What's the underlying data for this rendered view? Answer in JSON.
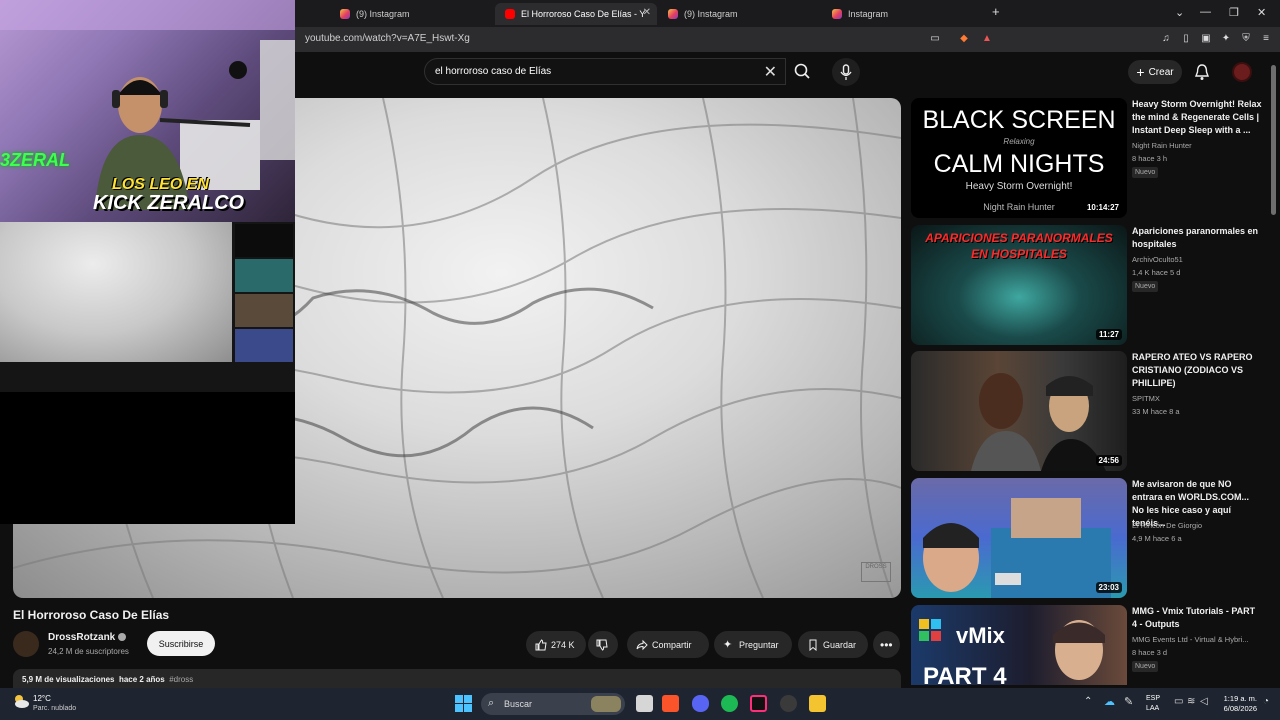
{
  "browser": {
    "tabs": [
      {
        "label": "(9) Instagram",
        "favicon": "instagram-icon",
        "active": false
      },
      {
        "label": "El Horroroso Caso De Elías - Y",
        "favicon": "youtube-icon",
        "active": true
      },
      {
        "label": "(9) Instagram",
        "favicon": "instagram-icon",
        "active": false
      },
      {
        "label": "Instagram",
        "favicon": "instagram-icon",
        "active": false
      }
    ],
    "new_tab_label": "+",
    "url": "youtube.com/watch?v=A7E_Hswt-Xg"
  },
  "youtube": {
    "search": {
      "value": "el horroroso caso de Elías"
    },
    "create_label": "Crear",
    "video": {
      "title": "El Horroroso Caso De Elías",
      "channel": "DrossRotzank",
      "subscribers": "24,2 M de suscriptores",
      "subscribe_label": "Suscribirse",
      "likes": "274 K",
      "share_label": "Compartir",
      "ask_label": "Preguntar",
      "save_label": "Guardar",
      "views": "5,9 M de visualizaciones",
      "age": "hace 2 años",
      "hashtag": "#dross",
      "watermark": "DROSS"
    },
    "recommendations": [
      {
        "title": "Heavy Storm Overnight! Relax the mind & Regenerate Cells | Instant Deep Sleep with a ...",
        "channel": "Night Rain Hunter",
        "meta": "8  hace 3 h",
        "badge": "Nuevo",
        "duration": "10:14:27",
        "thumb_lines": [
          "BLACK SCREEN",
          "Relaxing",
          "CALM NIGHTS",
          "Heavy Storm Overnight!",
          "Night Rain Hunter"
        ]
      },
      {
        "title": "Apariciones paranormales en hospitales",
        "channel": "ArchivOculto51",
        "meta": "1,4 K  hace 5 d",
        "badge": "Nuevo",
        "duration": "11:27",
        "thumb_lines": [
          "APARICIONES PARANORMALES",
          "EN HOSPITALES"
        ]
      },
      {
        "title": "RAPERO ATEO VS RAPERO CRISTIANO (ZODIACO VS PHILLIPE)",
        "channel": "SPITMX",
        "meta": "33 M  hace 8 a",
        "badge": "",
        "duration": "24:56"
      },
      {
        "title": "Me avisaron de que NO entrara en WORLDS.COM... No les hice caso y aquí tenéis...",
        "channel": "El Rincón De Giorgio",
        "meta": "4,9 M  hace 6 a",
        "badge": "",
        "duration": "23:03"
      },
      {
        "title": "MMG - Vmix Tutorials - PART 4 - Outputs",
        "channel": "MMG Events Ltd - Virtual & Hybri...",
        "meta": "8  hace 3 d",
        "badge": "Nuevo",
        "duration": "",
        "thumb_lines": [
          "vMix",
          "PART 4"
        ]
      }
    ]
  },
  "overlay": {
    "banner_line1": "LOS LEO EN",
    "banner_line2": "KICK ZERALCO",
    "side_text": "3ZERAL"
  },
  "taskbar": {
    "temperature": "12°C",
    "weather": "Parc. nublado",
    "search_label": "Buscar",
    "lang_line1": "ESP",
    "lang_line2": "LAA",
    "time": "1:19 a. m.",
    "date": "6/08/2026"
  },
  "colors": {
    "yt_bg": "#0f0f0f",
    "yt_red": "#ff0000",
    "pill_bg": "#272727",
    "taskbar_bg": "#1f2530"
  }
}
